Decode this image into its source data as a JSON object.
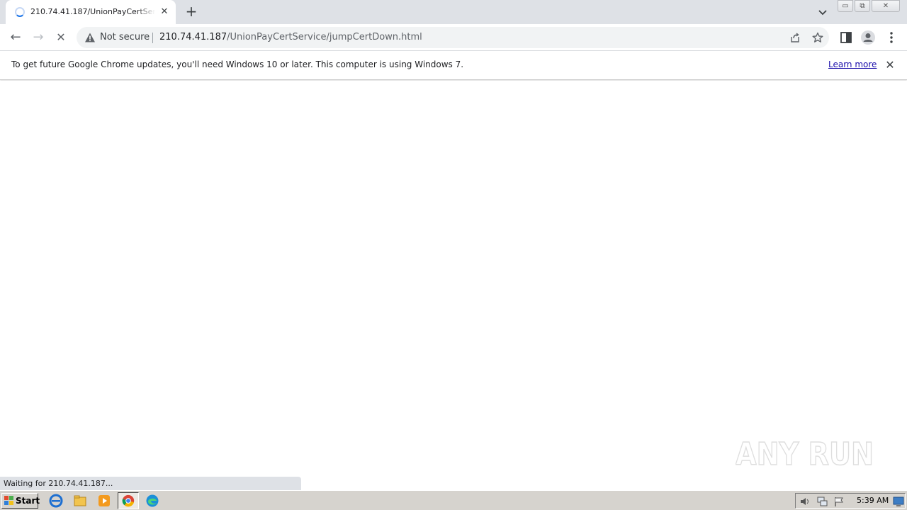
{
  "browser": {
    "tab": {
      "title": "210.74.41.187/UnionPayCertService/jumpCertDown.html",
      "close_glyph": "✕"
    },
    "new_tab_glyph": "+",
    "window_controls": {
      "minimize": "▭",
      "restore": "⧉",
      "close": "✕"
    },
    "nav": {
      "back_glyph": "←",
      "forward_glyph": "→",
      "stop_glyph": "✕"
    },
    "omnibox": {
      "security_label": "Not secure",
      "url_host": "210.74.41.187",
      "url_path": "/UnionPayCertService/jumpCertDown.html"
    }
  },
  "infobar": {
    "message": "To get future Google Chrome updates, you'll need Windows 10 or later. This computer is using Windows 7.",
    "link_label": "Learn more",
    "close_glyph": "✕"
  },
  "status": {
    "text": "Waiting for 210.74.41.187..."
  },
  "watermark": {
    "text": "ANY RUN"
  },
  "taskbar": {
    "start_label": "Start",
    "clock": "5:39 AM",
    "quick_launch": [
      "internet-explorer-icon",
      "file-explorer-icon",
      "media-player-icon",
      "chrome-icon",
      "edge-icon"
    ]
  },
  "colors": {
    "accent": "#1a73e8",
    "link": "#1a0dab",
    "tabstrip": "#dee1e6"
  }
}
